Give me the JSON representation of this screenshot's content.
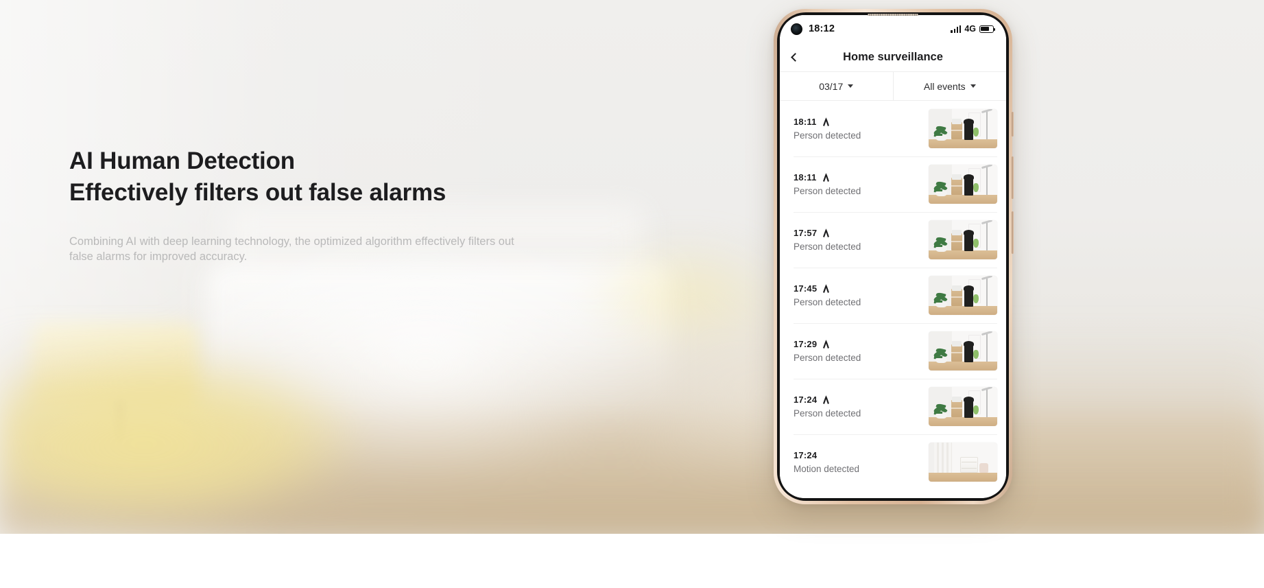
{
  "hero": {
    "headline_line1": "AI Human Detection",
    "headline_line2": "Effectively filters out false alarms",
    "subcopy": "Combining AI with deep learning technology, the optimized algorithm effectively filters out false alarms for improved accuracy."
  },
  "colors": {
    "headline": "#1d1d1f",
    "subcopy": "#b9b9b9",
    "phone_frame": "#e3c3a6",
    "background": "#f2f1ef"
  },
  "phone": {
    "status_bar": {
      "time": "18:12",
      "network": "4G",
      "signal_bars": 4,
      "battery_level": "72%"
    },
    "nav": {
      "back_icon": "chevron-left-icon",
      "title": "Home surveillance"
    },
    "filters": [
      {
        "label": "03/17",
        "icon": "chevron-down-icon"
      },
      {
        "label": "All events",
        "icon": "chevron-down-icon"
      }
    ],
    "events": [
      {
        "time": "18:11",
        "icon": "person-walking-icon",
        "label": "Person detected",
        "thumb": "person"
      },
      {
        "time": "18:11",
        "icon": "person-walking-icon",
        "label": "Person detected",
        "thumb": "person"
      },
      {
        "time": "17:57",
        "icon": "person-walking-icon",
        "label": "Person detected",
        "thumb": "person"
      },
      {
        "time": "17:45",
        "icon": "person-walking-icon",
        "label": "Person detected",
        "thumb": "person"
      },
      {
        "time": "17:29",
        "icon": "person-walking-icon",
        "label": "Person detected",
        "thumb": "person"
      },
      {
        "time": "17:24",
        "icon": "person-walking-icon",
        "label": "Person detected",
        "thumb": "person"
      },
      {
        "time": "17:24",
        "icon": "",
        "label": "Motion detected",
        "thumb": "room"
      }
    ]
  }
}
